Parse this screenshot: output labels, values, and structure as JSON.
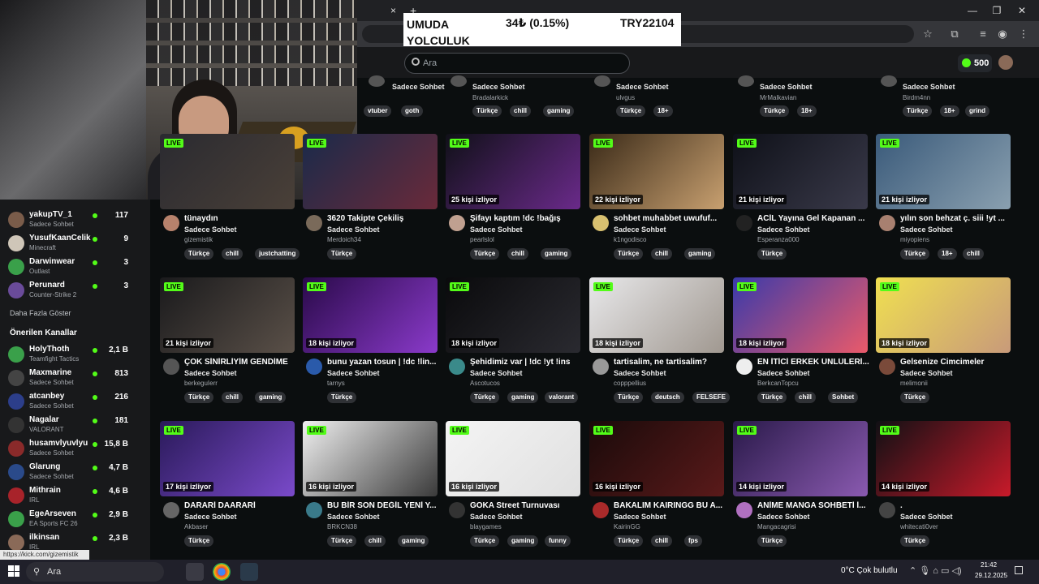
{
  "stock": {
    "name": "UMUDA YOLCULUK",
    "change": "34₺ (0.15%)",
    "price": "TRY22104"
  },
  "browser": {
    "close_tab": "×",
    "new_tab": "+",
    "minimize": "—",
    "maximize": "❐",
    "close": "✕"
  },
  "kick": {
    "search_placeholder": "Ara",
    "points": "500"
  },
  "sidebar": {
    "followed": [
      {
        "name": "yakupTV_1",
        "category": "Sadece Sohbet",
        "viewers": "117",
        "color": "#7a5c4a"
      },
      {
        "name": "YusufKaanCelik",
        "category": "Minecraft",
        "viewers": "9",
        "color": "#cfc6b8"
      },
      {
        "name": "Darwinwear",
        "category": "Outlast",
        "viewers": "3",
        "color": "#3aa04a"
      },
      {
        "name": "Perunard",
        "category": "Counter-Strike 2",
        "viewers": "3",
        "color": "#6a4b9a"
      }
    ],
    "more_label": "Daha Fazla Göster",
    "recommended_title": "Önerilen Kanallar",
    "recommended": [
      {
        "name": "HolyThoth",
        "category": "Teamfight Tactics",
        "viewers": "2,1 B",
        "color": "#3aa04a"
      },
      {
        "name": "Maxmarine",
        "category": "Sadece Sohbet",
        "viewers": "813",
        "color": "#444"
      },
      {
        "name": "atcanbey",
        "category": "Sadece Sohbet",
        "viewers": "216",
        "color": "#2c3e8a"
      },
      {
        "name": "Nagalar",
        "category": "VALORANT",
        "viewers": "181",
        "color": "#333"
      },
      {
        "name": "husamvlyuvlyu",
        "category": "Sadece Sohbet",
        "viewers": "15,8 B",
        "color": "#8a2a2a"
      },
      {
        "name": "Glarung",
        "category": "Sadece Sohbet",
        "viewers": "4,7 B",
        "color": "#2a4a8a"
      },
      {
        "name": "Mithrain",
        "category": "IRL",
        "viewers": "4,6 B",
        "color": "#a8232a"
      },
      {
        "name": "EgeArseven",
        "category": "EA Sports FC 26",
        "viewers": "2,9 B",
        "color": "#3aa04a"
      },
      {
        "name": "ilkinsan",
        "category": "IRL",
        "viewers": "2,3 B",
        "color": "#8a6a58"
      }
    ]
  },
  "top_row": [
    {
      "category": "Sadece Sohbet",
      "user": "",
      "tags": [
        "vtuber",
        "goth"
      ]
    },
    {
      "category": "Sadece Sohbet",
      "user": "Bradalarkick",
      "tags": [
        "Türkçe",
        "chill",
        "gaming"
      ]
    },
    {
      "category": "Sadece Sohbet",
      "user": "ulvgus",
      "tags": [
        "Türkçe",
        "18+"
      ]
    },
    {
      "category": "Sadece Sohbet",
      "user": "MrMalkavian",
      "tags": [
        "Türkçe",
        "18+"
      ]
    },
    {
      "category": "Sadece Sohbet",
      "user": "Birdm4nn",
      "tags": [
        "Türkçe",
        "18+",
        "grind"
      ]
    }
  ],
  "live_label": "LIVE",
  "rows": [
    [
      {
        "viewers": "",
        "title": "tünaydın",
        "category": "Sadece Sohbet",
        "user": "gizemistik",
        "tags": [
          "Türkçe",
          "chill",
          "justchatting"
        ],
        "c1": "#2a2a30",
        "c2": "#4a4038",
        "av": "#b7826c"
      },
      {
        "viewers": "",
        "title": "3620 Takipte Çekiliş",
        "category": "Sadece Sohbet",
        "user": "Merdoich34",
        "tags": [
          "Türkçe"
        ],
        "c1": "#1a2a4a",
        "c2": "#6a2a3a",
        "av": "#7a6a5a"
      },
      {
        "viewers": "25 kişi izliyor",
        "title": "Şifayı kaptım !dc !bağış",
        "category": "Sadece Sohbet",
        "user": "pearlslol",
        "tags": [
          "Türkçe",
          "chill",
          "gaming"
        ],
        "c1": "#101018",
        "c2": "#6a2a8a",
        "av": "#c0a090"
      },
      {
        "viewers": "22 kişi izliyor",
        "title": "sohbet muhabbet uwufuf...",
        "category": "Sadece Sohbet",
        "user": "k1ngodisco",
        "tags": [
          "Türkçe",
          "chill",
          "gaming"
        ],
        "c1": "#3a2a18",
        "c2": "#c8a070",
        "av": "#d8c070"
      },
      {
        "viewers": "21 kişi izliyor",
        "title": "ACİL Yayına Gel Kapanan ...",
        "category": "Sadece Sohbet",
        "user": "Esperanza000",
        "tags": [
          "Türkçe"
        ],
        "c1": "#0e1018",
        "c2": "#3a3a4a",
        "av": "#222"
      },
      {
        "viewers": "21 kişi izliyor",
        "title": "yılın son behzat ç. siii !yt ...",
        "category": "Sadece Sohbet",
        "user": "miyopiens",
        "tags": [
          "Türkçe",
          "18+",
          "chill"
        ],
        "c1": "#3a5a7a",
        "c2": "#8aa0b0",
        "av": "#a88070"
      }
    ],
    [
      {
        "viewers": "21 kişi izliyor",
        "title": "ÇOK SİNİRLİYİM GENDİME",
        "category": "Sadece Sohbet",
        "user": "berkeguIerr",
        "tags": [
          "Türkçe",
          "chill",
          "gaming"
        ],
        "c1": "#1a1a1c",
        "c2": "#5a5048",
        "av": "#555"
      },
      {
        "viewers": "18 kişi izliyor",
        "title": "bunu yazan tosun | !dc !lin...",
        "category": "Sadece Sohbet",
        "user": "tarnys",
        "tags": [
          "Türkçe"
        ],
        "c1": "#2a0a4a",
        "c2": "#8a3aca",
        "av": "#2a5aaa"
      },
      {
        "viewers": "18 kişi izliyor",
        "title": "Şehidimiz var | !dc !yt !ins",
        "category": "Sadece Sohbet",
        "user": "Ascotucos",
        "tags": [
          "Türkçe",
          "gaming",
          "valorant"
        ],
        "c1": "#0a0a0c",
        "c2": "#2a2a30",
        "av": "#3a8a8a"
      },
      {
        "viewers": "18 kişi izliyor",
        "title": "tartisalim, ne tartisalim?",
        "category": "Sadece Sohbet",
        "user": "copppellius",
        "tags": [
          "Türkçe",
          "deutsch",
          "FELSEFE"
        ],
        "c1": "#e8e8ea",
        "c2": "#a09890",
        "av": "#999"
      },
      {
        "viewers": "18 kişi izliyor",
        "title": "EN İTİCİ ERKEK ÜNLÜLERİ...",
        "category": "Sadece Sohbet",
        "user": "BerkcanTopcu",
        "tags": [
          "Türkçe",
          "chill",
          "Sohbet"
        ],
        "c1": "#3a3aaa",
        "c2": "#ea5a6a",
        "av": "#eee"
      },
      {
        "viewers": "18 kişi izliyor",
        "title": "Gelsenize Cimcimeler",
        "category": "Sadece Sohbet",
        "user": "melimonii",
        "tags": [
          "Türkçe"
        ],
        "c1": "#f0e050",
        "c2": "#c89a7a",
        "av": "#7a4a3a"
      }
    ],
    [
      {
        "viewers": "17 kişi izliyor",
        "title": "DARARİ DAARARİ",
        "category": "Sadece Sohbet",
        "user": "Akbaser",
        "tags": [
          "Türkçe"
        ],
        "c1": "#2a1a5a",
        "c2": "#7a4aca",
        "av": "#666"
      },
      {
        "viewers": "16 kişi izliyor",
        "title": "BU BİR SON DEĞİL YENİ Y...",
        "category": "Sadece Sohbet",
        "user": "BRKCN38",
        "tags": [
          "Türkçe",
          "chill",
          "gaming"
        ],
        "c1": "#f0f0f0",
        "c2": "#3a3a3a",
        "av": "#3a7a8a"
      },
      {
        "viewers": "16 kişi izliyor",
        "title": "GOKA Street Turnuvası",
        "category": "Sadece Sohbet",
        "user": "blaygames",
        "tags": [
          "Türkçe",
          "gaming",
          "funny"
        ],
        "c1": "#f4f4f4",
        "c2": "#e0e0e0",
        "av": "#333"
      },
      {
        "viewers": "16 kişi izliyor",
        "title": "BAKALIM KAIRINGG BU A...",
        "category": "Sadece Sohbet",
        "user": "KairinGG",
        "tags": [
          "Türkçe",
          "chill",
          "fps"
        ],
        "c1": "#1a0a0a",
        "c2": "#5a1a1a",
        "av": "#aa2a2a"
      },
      {
        "viewers": "14 kişi izliyor",
        "title": "ANİME MANGA SOHBETİ İ...",
        "category": "Sadece Sohbet",
        "user": "Mangacagrisi",
        "tags": [
          "Türkçe"
        ],
        "c1": "#2a1a4a",
        "c2": "#8a5ab0",
        "av": "#b070c0"
      },
      {
        "viewers": "14 kişi izliyor",
        "title": ".",
        "category": "Sadece Sohbet",
        "user": "whitecati0ver",
        "tags": [
          "Türkçe"
        ],
        "c1": "#101014",
        "c2": "#c81a2a",
        "av": "#444"
      }
    ]
  ],
  "status_url": "https://kick.com/gizemistik",
  "taskbar": {
    "search": "Ara",
    "weather": "0°C  Çok bulutlu",
    "time": "21:42",
    "date": "29.12.2025"
  }
}
